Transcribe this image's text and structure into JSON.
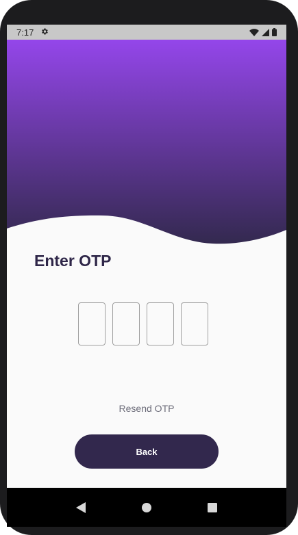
{
  "status_bar": {
    "time": "7:17",
    "icons": [
      "settings-gear-icon",
      "wifi-icon",
      "signal-icon",
      "battery-icon"
    ]
  },
  "hero": {
    "gradient_top": "#9446ea",
    "gradient_bottom": "#33294f"
  },
  "otp": {
    "title": "Enter OTP",
    "digits": [
      "",
      "",
      "",
      ""
    ],
    "resend_label": "Resend OTP"
  },
  "actions": {
    "back_label": "Back",
    "back_color": "#32284d"
  },
  "nav_bar": {
    "icons": [
      "back-triangle-icon",
      "home-circle-icon",
      "recents-square-icon"
    ]
  }
}
